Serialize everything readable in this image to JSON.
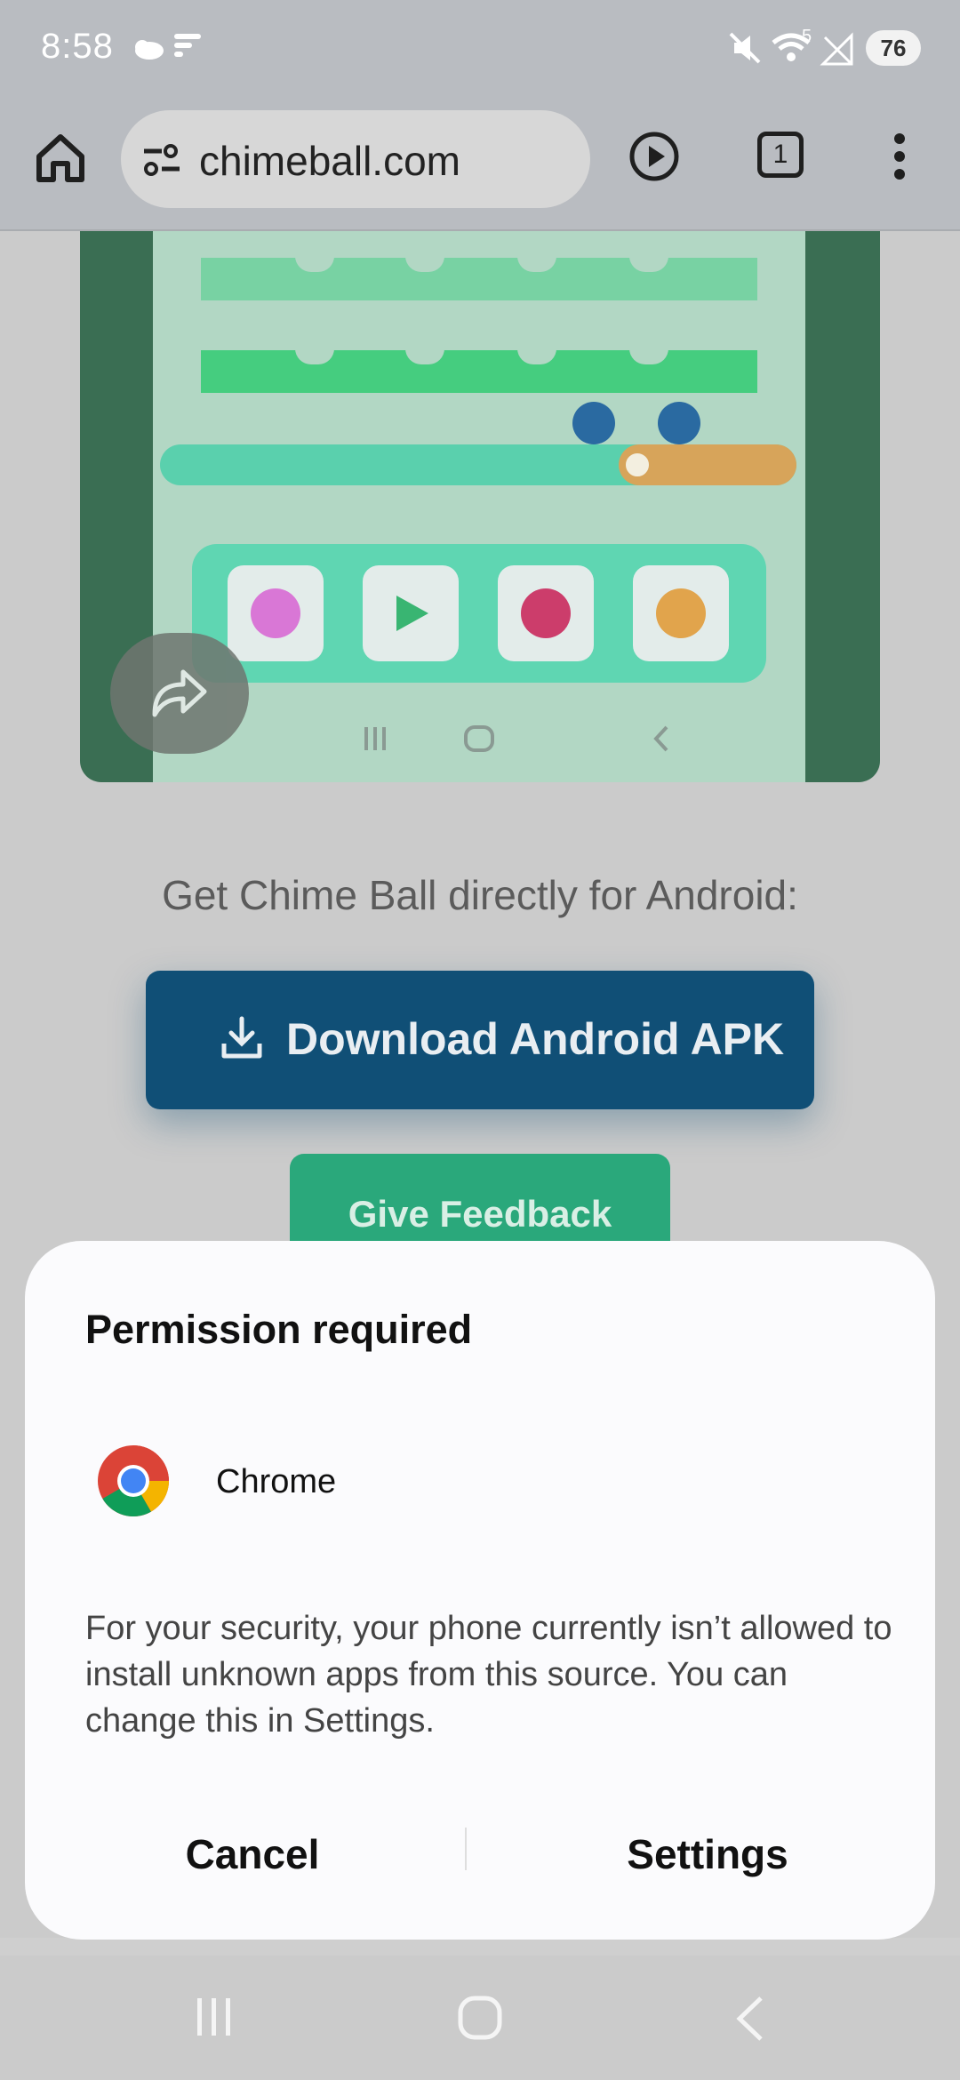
{
  "status_bar": {
    "time": "8:58",
    "battery": "76",
    "signal_badge": "5"
  },
  "browser": {
    "url": "chimeball.com",
    "tab_count": "1"
  },
  "page": {
    "get_text": "Get Chime Ball directly for Android:",
    "download_label": "Download Android APK",
    "feedback_label": "Give Feedback"
  },
  "dialog": {
    "title": "Permission required",
    "app_name": "Chrome",
    "message": "For your security, your phone currently isn’t allowed to install unknown apps from this source. You can change this in Settings.",
    "cancel": "Cancel",
    "settings": "Settings"
  },
  "colors": {
    "primary": "#104f76",
    "feedback": "#2aa87b",
    "dialog_bg": "#fbfbfd"
  }
}
